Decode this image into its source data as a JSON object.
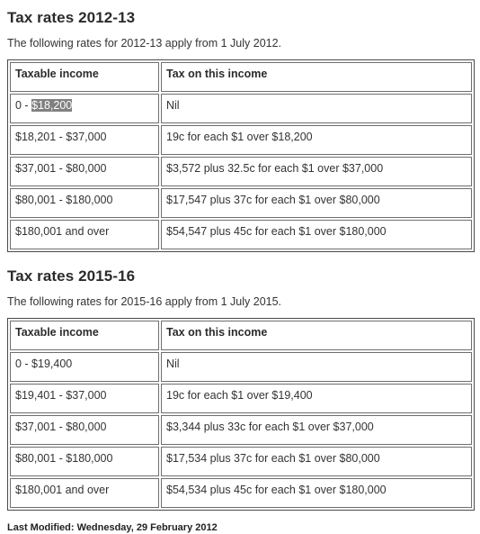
{
  "sections": [
    {
      "heading": "Tax rates 2012-13",
      "intro": "The following rates for 2012-13 apply from 1 July 2012.",
      "columns": [
        "Taxable income",
        "Tax on this income"
      ],
      "rows": [
        {
          "income_prefix": "0 - ",
          "income_selected": "$18,200",
          "income": "0 - $18,200",
          "tax": "Nil"
        },
        {
          "income": "$18,201 - $37,000",
          "tax": "19c for each $1 over $18,200"
        },
        {
          "income": "$37,001 - $80,000",
          "tax": "$3,572 plus 32.5c for each $1 over $37,000"
        },
        {
          "income": "$80,001 - $180,000",
          "tax": "$17,547 plus 37c for each $1 over $80,000"
        },
        {
          "income": "$180,001 and over",
          "tax": "$54,547 plus 45c for each $1 over $180,000"
        }
      ]
    },
    {
      "heading": "Tax rates 2015-16",
      "intro": "The following rates for 2015-16 apply from 1 July 2015.",
      "columns": [
        "Taxable income",
        "Tax on this income"
      ],
      "rows": [
        {
          "income": "0 - $19,400",
          "tax": "Nil"
        },
        {
          "income": "$19,401 - $37,000",
          "tax": "19c for each $1 over $19,400"
        },
        {
          "income": "$37,001 - $80,000",
          "tax": "$3,344 plus 33c for each $1 over $37,000"
        },
        {
          "income": "$80,001 - $180,000",
          "tax": "$17,534 plus 37c for each $1 over $80,000"
        },
        {
          "income": "$180,001 and over",
          "tax": "$54,534 plus 45c for each $1 over $180,000"
        }
      ]
    }
  ],
  "footer": {
    "last_modified": "Last Modified: Wednesday, 29 February 2012"
  },
  "colors": {
    "text": "#333333",
    "table_border": "#4a4a4a",
    "cell_border": "#6e6e6e",
    "selection_background": "#808080",
    "selection_text": "#ffffff",
    "page_background": "#ffffff"
  }
}
